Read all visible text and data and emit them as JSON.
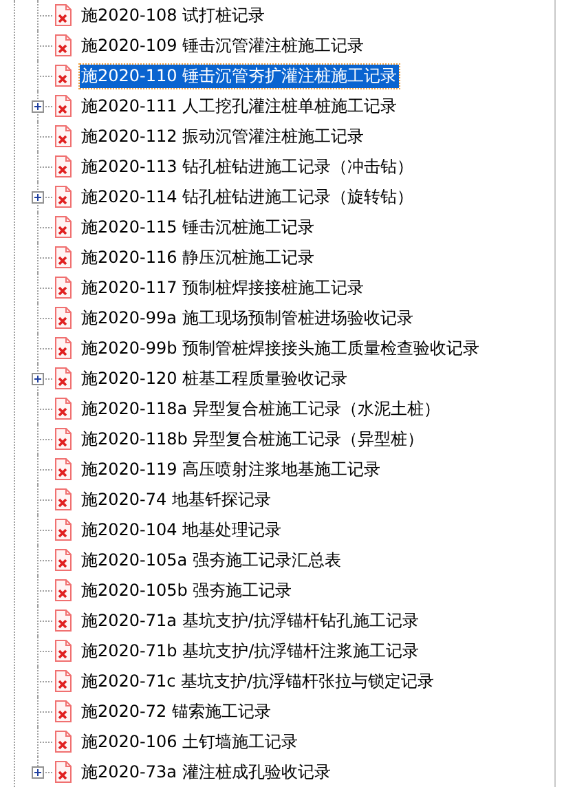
{
  "tree": {
    "items": [
      {
        "label": "施2020-108 试打桩记录",
        "selected": false,
        "expandable": false
      },
      {
        "label": "施2020-109 锤击沉管灌注桩施工记录",
        "selected": false,
        "expandable": false
      },
      {
        "label": "施2020-110 锤击沉管夯扩灌注桩施工记录",
        "selected": true,
        "expandable": false
      },
      {
        "label": "施2020-111 人工挖孔灌注桩单桩施工记录",
        "selected": false,
        "expandable": true
      },
      {
        "label": "施2020-112 振动沉管灌注桩施工记录",
        "selected": false,
        "expandable": false
      },
      {
        "label": "施2020-113 钻孔桩钻进施工记录（冲击钻）",
        "selected": false,
        "expandable": false
      },
      {
        "label": "施2020-114 钻孔桩钻进施工记录（旋转钻）",
        "selected": false,
        "expandable": true
      },
      {
        "label": "施2020-115 锤击沉桩施工记录",
        "selected": false,
        "expandable": false
      },
      {
        "label": "施2020-116 静压沉桩施工记录",
        "selected": false,
        "expandable": false
      },
      {
        "label": "施2020-117 预制桩焊接接桩施工记录",
        "selected": false,
        "expandable": false
      },
      {
        "label": "施2020-99a 施工现场预制管桩进场验收记录",
        "selected": false,
        "expandable": false
      },
      {
        "label": "施2020-99b 预制管桩焊接接头施工质量检查验收记录",
        "selected": false,
        "expandable": false
      },
      {
        "label": "施2020-120 桩基工程质量验收记录",
        "selected": false,
        "expandable": true
      },
      {
        "label": "施2020-118a 异型复合桩施工记录（水泥土桩）",
        "selected": false,
        "expandable": false
      },
      {
        "label": "施2020-118b 异型复合桩施工记录（异型桩）",
        "selected": false,
        "expandable": false
      },
      {
        "label": "施2020-119 高压喷射注浆地基施工记录",
        "selected": false,
        "expandable": false
      },
      {
        "label": "施2020-74 地基钎探记录",
        "selected": false,
        "expandable": false
      },
      {
        "label": "施2020-104 地基处理记录",
        "selected": false,
        "expandable": false
      },
      {
        "label": "施2020-105a 强夯施工记录汇总表",
        "selected": false,
        "expandable": false
      },
      {
        "label": "施2020-105b 强夯施工记录",
        "selected": false,
        "expandable": false
      },
      {
        "label": "施2020-71a 基坑支护/抗浮锚杆钻孔施工记录",
        "selected": false,
        "expandable": false
      },
      {
        "label": "施2020-71b 基坑支护/抗浮锚杆注浆施工记录",
        "selected": false,
        "expandable": false
      },
      {
        "label": "施2020-71c 基坑支护/抗浮锚杆张拉与锁定记录",
        "selected": false,
        "expandable": false
      },
      {
        "label": "施2020-72 锚索施工记录",
        "selected": false,
        "expandable": false
      },
      {
        "label": "施2020-106 土钉墙施工记录",
        "selected": false,
        "expandable": false
      },
      {
        "label": "施2020-73a 灌注桩成孔验收记录",
        "selected": false,
        "expandable": true
      }
    ]
  }
}
